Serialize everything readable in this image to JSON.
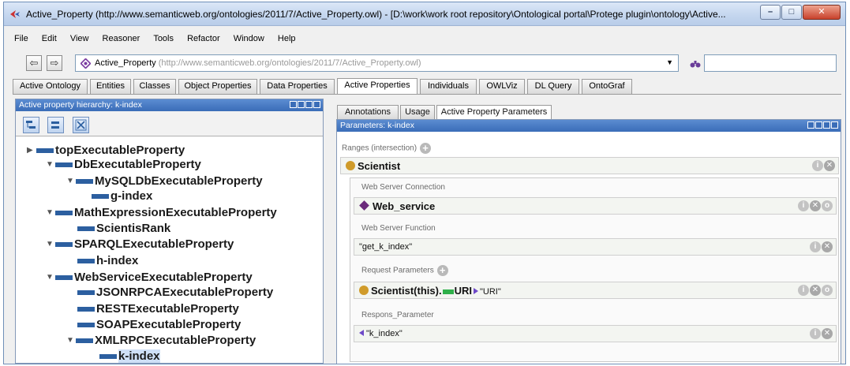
{
  "window": {
    "title": "Active_Property (http://www.semanticweb.org/ontologies/2011/7/Active_Property.owl) - [D:\\work\\work root repository\\Ontological portal\\Protege plugin\\ontology\\Active...",
    "min_glyph": "–",
    "max_glyph": "□",
    "close_glyph": "✕"
  },
  "menu": [
    "File",
    "Edit",
    "View",
    "Reasoner",
    "Tools",
    "Refactor",
    "Window",
    "Help"
  ],
  "address": {
    "back_glyph": "⇦",
    "forward_glyph": "⇨",
    "ontology_name": "Active_Property",
    "ontology_url": "(http://www.semanticweb.org/ontologies/2011/7/Active_Property.owl)",
    "dropdown_glyph": "▼",
    "search_value": ""
  },
  "main_tabs": [
    {
      "label": "Active Ontology"
    },
    {
      "label": "Entities"
    },
    {
      "label": "Classes"
    },
    {
      "label": "Object Properties"
    },
    {
      "label": "Data Properties"
    },
    {
      "label": "Active Properties"
    },
    {
      "label": "Individuals"
    },
    {
      "label": "OWLViz"
    },
    {
      "label": "DL Query"
    },
    {
      "label": "OntoGraf"
    }
  ],
  "active_main_tab": "Active Properties",
  "left_panel": {
    "title": "Active property hierarchy: k-index",
    "tree": [
      {
        "label": "topExecutableProperty",
        "toggle": "▶"
      },
      {
        "label": "DbExecutableProperty",
        "toggle": "▼"
      },
      {
        "label": "MySQLDbExecutableProperty",
        "toggle": "▼"
      },
      {
        "label": "g-index",
        "toggle": ""
      },
      {
        "label": "MathExpressionExecutableProperty",
        "toggle": "▼"
      },
      {
        "label": "ScientisRank",
        "toggle": ""
      },
      {
        "label": "SPARQLExecutableProperty",
        "toggle": "▼"
      },
      {
        "label": "h-index",
        "toggle": ""
      },
      {
        "label": "WebServiceExecutableProperty",
        "toggle": "▼"
      },
      {
        "label": "JSONRPCAExecutableProperty",
        "toggle": ""
      },
      {
        "label": "RESTExecutableProperty",
        "toggle": ""
      },
      {
        "label": "SOAPExecutableProperty",
        "toggle": ""
      },
      {
        "label": "XMLRPCExecutableProperty",
        "toggle": "▼"
      },
      {
        "label": "k-index",
        "toggle": ""
      }
    ]
  },
  "right_tabs": [
    {
      "label": "Annotations"
    },
    {
      "label": "Usage"
    },
    {
      "label": "Active Property Parameters"
    }
  ],
  "right_panel": {
    "title": "Parameters: k-index",
    "ranges_label": "Ranges (intersection)",
    "range_value": "Scientist",
    "web_server_connection_label": "Web Server Connection",
    "web_server_connection_value": "Web_service",
    "web_server_function_label": "Web Server Function",
    "web_server_function_value": "\"get_k_index\"",
    "request_parameters_label": "Request Parameters",
    "request_param_prefix": "Scientist(this).",
    "request_param_uri": "URI",
    "request_param_value": "\"URI\"",
    "respons_parameter_label": "Respons_Parameter",
    "respons_parameter_value": "\"k_index\""
  },
  "colors": {
    "panel_header": "#3a6db8",
    "tree_bar": "#2c5fa0",
    "class_dot": "#d09b2a",
    "individual_diamond": "#6a2a7a",
    "data_bar": "#2fb04a",
    "arrow": "#6e49c8"
  }
}
